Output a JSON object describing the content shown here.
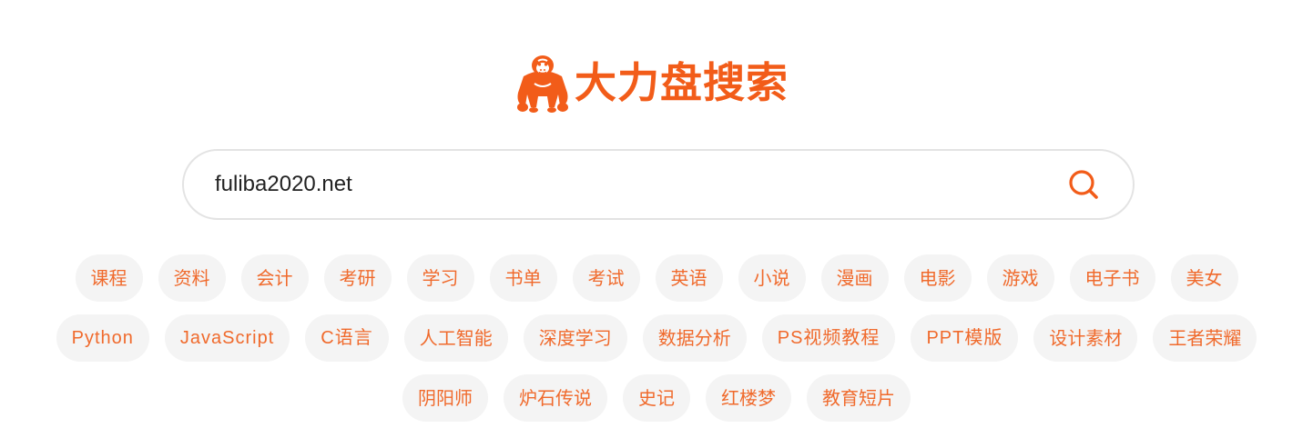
{
  "brand": {
    "title": "大力盘搜索",
    "logo_icon": "gorilla-logo-icon",
    "color": "#f25c19"
  },
  "search": {
    "value": "fuliba2020.net",
    "button_icon": "search-icon",
    "accent": "#f25c19"
  },
  "tags": {
    "rows": [
      [
        "课程",
        "资料",
        "会计",
        "考研",
        "学习",
        "书单",
        "考试",
        "英语",
        "小说",
        "漫画",
        "电影",
        "游戏",
        "电子书",
        "美女"
      ],
      [
        "Python",
        "JavaScript",
        "C语言",
        "人工智能",
        "深度学习",
        "数据分析",
        "PS视频教程",
        "PPT模版",
        "设计素材",
        "王者荣耀"
      ],
      [
        "阴阳师",
        "炉石传说",
        "史记",
        "红楼梦",
        "教育短片"
      ]
    ],
    "text_color": "#f06a2c",
    "background": "#f4f4f4"
  }
}
